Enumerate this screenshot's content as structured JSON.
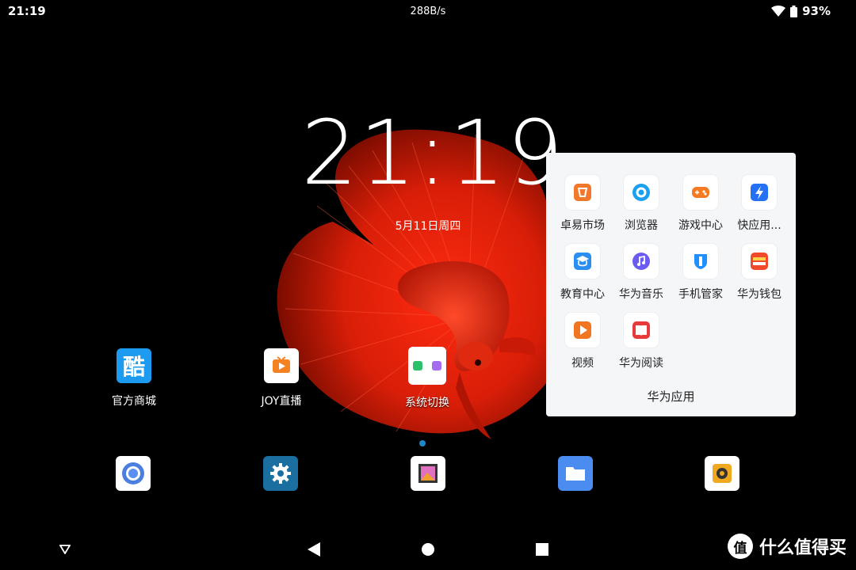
{
  "status_bar": {
    "time": "21:19",
    "net_speed": "288B/s",
    "battery": "93%",
    "icons": [
      "wifi-icon",
      "battery-icon"
    ]
  },
  "clock": {
    "time": "21:19",
    "date": "5月11日周四"
  },
  "home_apps": [
    {
      "label": "官方商城",
      "icon": "store-icon"
    },
    {
      "label": "JOY直播",
      "icon": "live-icon"
    },
    {
      "label": "系统切换",
      "icon": "system-switch-icon"
    }
  ],
  "folder": {
    "title": "华为应用",
    "apps": [
      {
        "label": "卓易市场",
        "icon": "market-icon",
        "color": "#f2792b"
      },
      {
        "label": "浏览器",
        "icon": "browser-icon",
        "color": "#1aa0f0"
      },
      {
        "label": "游戏中心",
        "icon": "game-icon",
        "color": "#f47b22"
      },
      {
        "label": "快应用...",
        "icon": "quick-app-icon",
        "color": "#2471f5"
      },
      {
        "label": "教育中心",
        "icon": "education-icon",
        "color": "#2b8ff2"
      },
      {
        "label": "华为音乐",
        "icon": "music-icon",
        "color": "#6a5cf2"
      },
      {
        "label": "手机管家",
        "icon": "phone-manager-icon",
        "color": "#1e90ff"
      },
      {
        "label": "华为钱包",
        "icon": "wallet-icon",
        "color": "#f04a2a"
      },
      {
        "label": "视频",
        "icon": "video-icon",
        "color": "#f27522"
      },
      {
        "label": "华为阅读",
        "icon": "reading-icon",
        "color": "#e83a3a"
      }
    ]
  },
  "dock": [
    {
      "icon": "chrome-browser-icon"
    },
    {
      "icon": "settings-gear-icon"
    },
    {
      "icon": "gallery-icon"
    },
    {
      "icon": "files-folder-icon"
    },
    {
      "icon": "camera-icon"
    }
  ],
  "nav": [
    "collapse-icon",
    "back-icon",
    "home-icon",
    "recents-icon"
  ],
  "watermark": {
    "logo": "值",
    "text": "什么值得买"
  }
}
